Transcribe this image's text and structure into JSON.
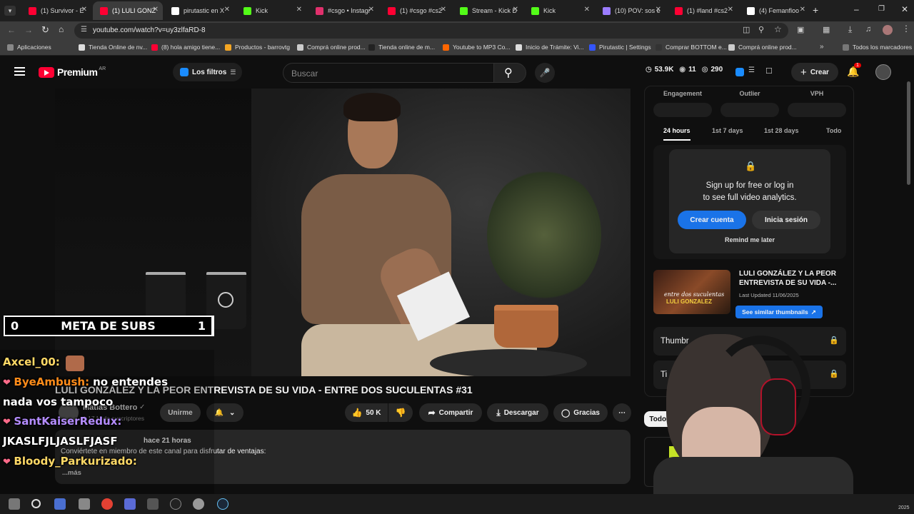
{
  "browser": {
    "tabs": [
      {
        "title": "(1) Survivor - E",
        "color": "#ff0033"
      },
      {
        "title": "(1) LULI GONZ",
        "color": "#ff0033",
        "active": true
      },
      {
        "title": "pirutastic en X",
        "color": "#ffffff"
      },
      {
        "title": "Kick",
        "color": "#53fc18"
      },
      {
        "title": "#csgo • Instagr",
        "color": "#e1306c"
      },
      {
        "title": "(1) #csgo #cs2",
        "color": "#ff0033"
      },
      {
        "title": "Stream - Kick D",
        "color": "#53fc18"
      },
      {
        "title": "Kick",
        "color": "#53fc18"
      },
      {
        "title": "(10) POV: sos e",
        "color": "#9b7cff"
      },
      {
        "title": "(1) #land #cs2",
        "color": "#ff0033"
      },
      {
        "title": "(4) Femanfloo",
        "color": "#ffffff"
      }
    ],
    "url": "youtube.com/watch?v=uy3zlfaRD-8",
    "bookmarks": [
      {
        "label": "Aplicaciones",
        "color": "#888888"
      },
      {
        "label": "Tienda Online de nv...",
        "color": "#dddddd"
      },
      {
        "label": "(8) hola amigo tiene...",
        "color": "#ff0033"
      },
      {
        "label": "Productos - barrovtg",
        "color": "#f5a623"
      },
      {
        "label": "Comprá online prod...",
        "color": "#cccccc"
      },
      {
        "label": "Tienda online de m...",
        "color": "#222222"
      },
      {
        "label": "Youtube to MP3 Co...",
        "color": "#ff6600"
      },
      {
        "label": "Inicio de Trámite: Vi...",
        "color": "#dddddd"
      },
      {
        "label": "Pirutastic | Settings",
        "color": "#3355ff"
      },
      {
        "label": "Comprar BOTTOM e...",
        "color": "#333333"
      },
      {
        "label": "Comprá online prod...",
        "color": "#cccccc"
      }
    ],
    "all_bookmarks": "Todos los marcadores"
  },
  "youtube": {
    "logo": "Premium",
    "region": "AR",
    "filters_label": "Los filtros",
    "search_placeholder": "Buscar",
    "stats": {
      "views": "53.9K",
      "likes": "11",
      "watchers": "290"
    },
    "create_label": "Crear",
    "notif_count": "1"
  },
  "video": {
    "title": "LULI GONZÁLEZ Y LA PEOR ENTREVISTA DE SU VIDA - ENTRE DOS SUCULENTAS #31",
    "channel": "Matías Bottero",
    "subs": "1,17 M de suscriptores",
    "join_label": "Unirme",
    "likes": "50 K",
    "share": "Compartir",
    "download": "Descargar",
    "thanks": "Gracias",
    "desc_meta": "hace 21 horas",
    "desc_line": "Conviértete en miembro de este canal para disfrutar de ventajas:",
    "more": "...más"
  },
  "overlay": {
    "goal_left": "0",
    "goal_label": "META DE SUBS",
    "goal_right": "1",
    "chat": [
      {
        "user": "Axcel_00:",
        "msg": "",
        "color": "#ffd966"
      },
      {
        "user": "ByeAmbush:",
        "msg": "no entendes",
        "color": "#ff8c1a"
      },
      {
        "user": "",
        "msg": "nada vos tampoco",
        "color": "#ffffff"
      },
      {
        "user": "SantKaiserRedux:",
        "msg": "",
        "color": "#b48cff"
      },
      {
        "user": "",
        "msg": "JKASLFJLJASLFJASF",
        "color": "#ffffff"
      },
      {
        "user": "Bloody_Parkurizado:",
        "msg": "",
        "color": "#ffd966"
      }
    ]
  },
  "panel": {
    "metrics": [
      "Engagement",
      "Outlier",
      "VPH"
    ],
    "ranges": [
      "24 hours",
      "1st 7 days",
      "1st 28 days",
      "Todo"
    ],
    "lock_line1": "Sign up for free or log in",
    "lock_line2": "to see full video analytics.",
    "create_account": "Crear cuenta",
    "login": "Inicia sesión",
    "remind": "Remind me later",
    "thumb_title": "LULI GONZÁLEZ Y LA PEOR ENTREVISTA DE SU VIDA -...",
    "thumb_updated": "Last Updated 11/06/2025",
    "thumb_btn": "See similar thumbnails",
    "thumb_text": "entre dos suculentas",
    "thumb_name": "LULI GONZALEZ",
    "row1": "Thumbr",
    "row2": "Ti",
    "chip": "Todos"
  },
  "taskbar": {
    "year": "2025"
  }
}
